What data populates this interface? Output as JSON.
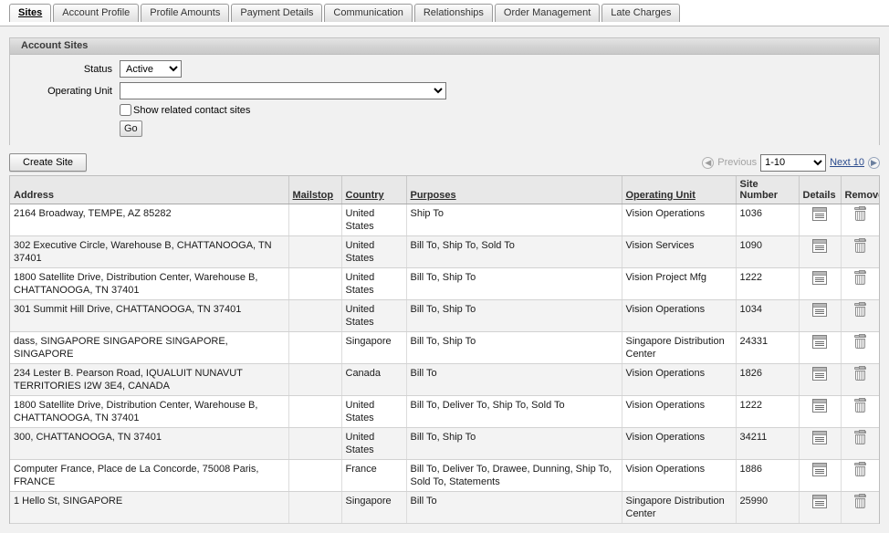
{
  "tabs": [
    {
      "label": "Sites",
      "selected": true
    },
    {
      "label": "Account Profile",
      "selected": false
    },
    {
      "label": "Profile Amounts",
      "selected": false
    },
    {
      "label": "Payment Details",
      "selected": false
    },
    {
      "label": "Communication",
      "selected": false
    },
    {
      "label": "Relationships",
      "selected": false
    },
    {
      "label": "Order Management",
      "selected": false
    },
    {
      "label": "Late Charges",
      "selected": false
    }
  ],
  "region": {
    "title": "Account Sites"
  },
  "form": {
    "status_label": "Status",
    "status_value": "Active",
    "status_options": [
      "Active"
    ],
    "operating_unit_label": "Operating Unit",
    "operating_unit_value": "",
    "operating_unit_options": [
      ""
    ],
    "show_related_label": "Show related contact sites",
    "show_related_checked": false,
    "go_label": "Go"
  },
  "actions": {
    "create_site_label": "Create Site"
  },
  "pager": {
    "previous_label": "Previous",
    "previous_enabled": false,
    "range_value": "1-10",
    "range_options": [
      "1-10"
    ],
    "next_label": "Next 10",
    "next_enabled": true
  },
  "table": {
    "columns": [
      {
        "key": "address",
        "label": "Address",
        "sortable": false
      },
      {
        "key": "mailstop",
        "label": "Mailstop",
        "sortable": true
      },
      {
        "key": "country",
        "label": "Country",
        "sortable": true
      },
      {
        "key": "purposes",
        "label": "Purposes",
        "sortable": true
      },
      {
        "key": "operating_unit",
        "label": "Operating Unit",
        "sortable": true
      },
      {
        "key": "site_number",
        "label": "Site Number",
        "sortable": false
      },
      {
        "key": "details",
        "label": "Details",
        "sortable": false
      },
      {
        "key": "remove",
        "label": "Remove",
        "sortable": false
      }
    ],
    "rows": [
      {
        "address": "2164 Broadway, TEMPE, AZ 85282",
        "mailstop": "",
        "country": "United States",
        "purposes": "Ship To",
        "operating_unit": "Vision Operations",
        "site_number": "1036",
        "details_icon": "details-icon",
        "remove_icon": "trash-icon"
      },
      {
        "address": "302 Executive Circle, Warehouse B, CHATTANOOGA, TN 37401",
        "mailstop": "",
        "country": "United States",
        "purposes": "Bill To, Ship To, Sold To",
        "operating_unit": "Vision Services",
        "site_number": "1090",
        "details_icon": "details-icon",
        "remove_icon": "trash-icon"
      },
      {
        "address": "1800 Satellite Drive, Distribution Center, Warehouse B, CHATTANOOGA, TN 37401",
        "mailstop": "",
        "country": "United States",
        "purposes": "Bill To, Ship To",
        "operating_unit": "Vision Project Mfg",
        "site_number": "1222",
        "details_icon": "details-icon",
        "remove_icon": "trash-icon"
      },
      {
        "address": "301 Summit Hill Drive, CHATTANOOGA, TN 37401",
        "mailstop": "",
        "country": "United States",
        "purposes": "Bill To, Ship To",
        "operating_unit": "Vision Operations",
        "site_number": "1034",
        "details_icon": "details-icon",
        "remove_icon": "trash-icon"
      },
      {
        "address": "dass, SINGAPORE SINGAPORE SINGAPORE, SINGAPORE",
        "mailstop": "",
        "country": "Singapore",
        "purposes": "Bill To, Ship To",
        "operating_unit": "Singapore Distribution Center",
        "site_number": "24331",
        "details_icon": "details-icon",
        "remove_icon": "trash-icon"
      },
      {
        "address": "234 Lester B. Pearson Road, IQUALUIT NUNAVUT TERRITORIES I2W 3E4, CANADA",
        "mailstop": "",
        "country": "Canada",
        "purposes": "Bill To",
        "operating_unit": "Vision Operations",
        "site_number": "1826",
        "details_icon": "details-icon",
        "remove_icon": "trash-icon"
      },
      {
        "address": "1800 Satellite Drive, Distribution Center, Warehouse B, CHATTANOOGA, TN 37401",
        "mailstop": "",
        "country": "United States",
        "purposes": "Bill To, Deliver To, Ship To, Sold To",
        "operating_unit": "Vision Operations",
        "site_number": "1222",
        "details_icon": "details-icon",
        "remove_icon": "trash-icon"
      },
      {
        "address": "300, CHATTANOOGA, TN 37401",
        "mailstop": "",
        "country": "United States",
        "purposes": "Bill To, Ship To",
        "operating_unit": "Vision Operations",
        "site_number": "34211",
        "details_icon": "details-icon",
        "remove_icon": "trash-icon"
      },
      {
        "address": "Computer France, Place de La Concorde, 75008 Paris, FRANCE",
        "mailstop": "",
        "country": "France",
        "purposes": "Bill To, Deliver To, Drawee, Dunning, Ship To, Sold To, Statements",
        "operating_unit": "Vision Operations",
        "site_number": "1886",
        "details_icon": "details-icon",
        "remove_icon": "trash-icon"
      },
      {
        "address": "1 Hello St, SINGAPORE",
        "mailstop": "",
        "country": "Singapore",
        "purposes": "Bill To",
        "operating_unit": "Singapore Distribution Center",
        "site_number": "25990",
        "details_icon": "details-icon",
        "remove_icon": "trash-icon"
      }
    ]
  },
  "colors": {
    "page_background": "#f1f1f1",
    "region_header": "#d4d4d4",
    "table_header": "#e8e8e8",
    "row_even": "#f3f3f3",
    "row_odd": "#ffffff",
    "link": "#2a4b8d",
    "disabled_text": "#a2a2a2"
  }
}
